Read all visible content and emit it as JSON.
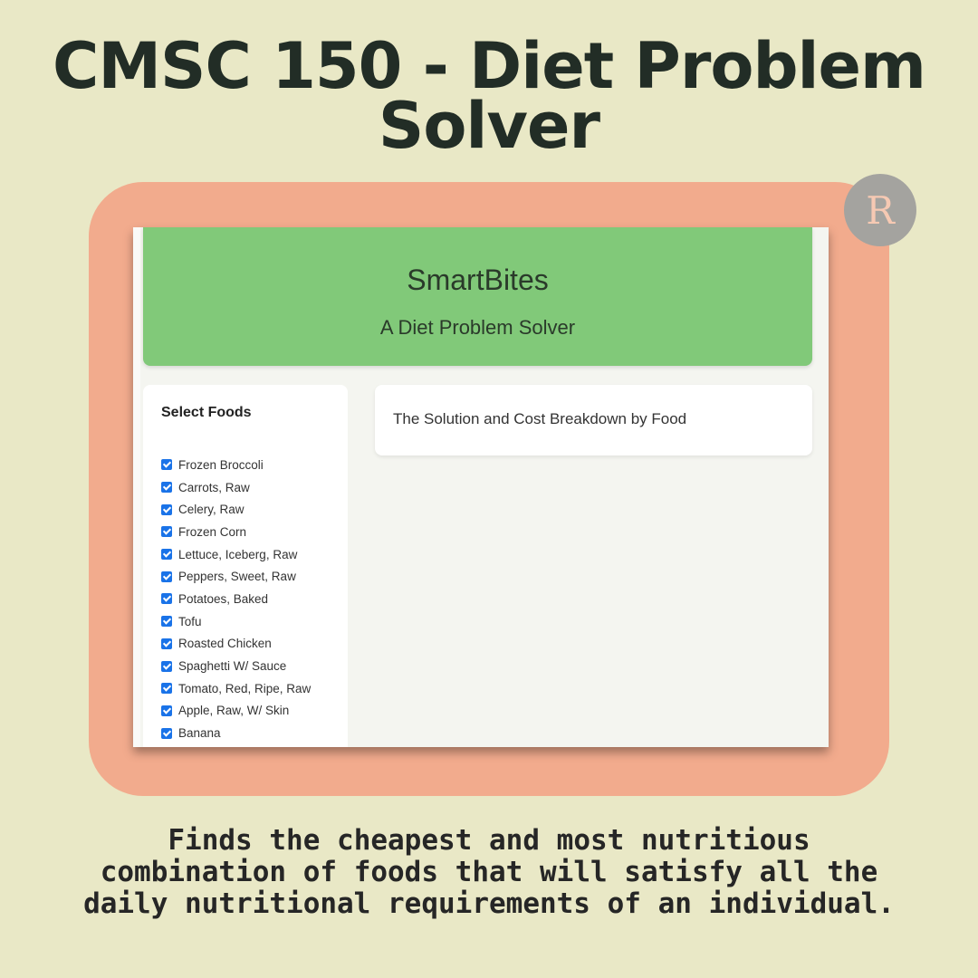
{
  "title": "CMSC 150 - Diet Problem Solver",
  "logo_letter": "R",
  "app": {
    "name": "SmartBites",
    "subtitle": "A Diet Problem Solver",
    "select_foods_title": "Select Foods",
    "foods": [
      {
        "label": "Frozen Broccoli",
        "checked": true
      },
      {
        "label": "Carrots, Raw",
        "checked": true
      },
      {
        "label": "Celery, Raw",
        "checked": true
      },
      {
        "label": "Frozen Corn",
        "checked": true
      },
      {
        "label": "Lettuce, Iceberg, Raw",
        "checked": true
      },
      {
        "label": "Peppers, Sweet, Raw",
        "checked": true
      },
      {
        "label": "Potatoes, Baked",
        "checked": true
      },
      {
        "label": "Tofu",
        "checked": true
      },
      {
        "label": "Roasted Chicken",
        "checked": true
      },
      {
        "label": "Spaghetti W/ Sauce",
        "checked": true
      },
      {
        "label": "Tomato, Red, Ripe, Raw",
        "checked": true
      },
      {
        "label": "Apple, Raw, W/ Skin",
        "checked": true
      },
      {
        "label": "Banana",
        "checked": true
      }
    ],
    "solution_title": "The Solution and Cost Breakdown by Food"
  },
  "caption": "Finds the cheapest and most nutritious combination of foods that will satisfy all the daily nutritional requirements of an individual.",
  "colors": {
    "background": "#e9e8c6",
    "frame": "#f2ab8d",
    "header": "#81c979",
    "checkbox": "#1a73e8",
    "title_text": "#222d26"
  }
}
